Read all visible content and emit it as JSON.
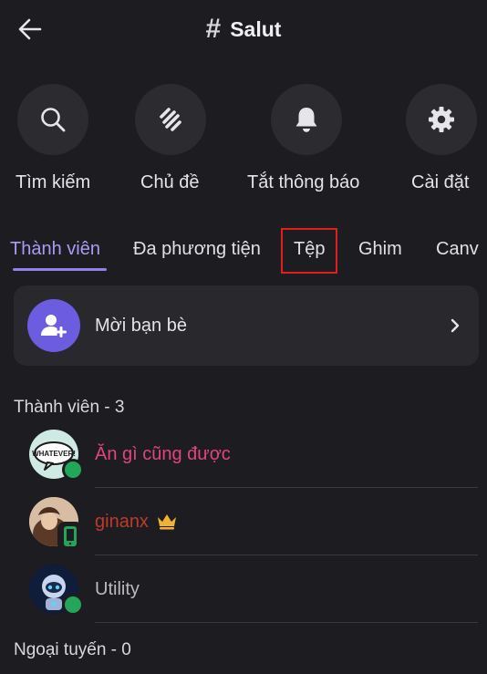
{
  "header": {
    "title": "Salut",
    "hash": "#"
  },
  "actions": [
    {
      "label": "Tìm kiếm",
      "icon": "search-icon"
    },
    {
      "label": "Chủ đề",
      "icon": "threads-icon"
    },
    {
      "label": "Tắt thông báo",
      "icon": "bell-icon"
    },
    {
      "label": "Cài đặt",
      "icon": "gear-icon"
    }
  ],
  "tabs": [
    {
      "label": "Thành viên",
      "active": true
    },
    {
      "label": "Đa phương tiện",
      "active": false
    },
    {
      "label": "Tệp",
      "active": false
    },
    {
      "label": "Ghim",
      "active": false
    },
    {
      "label": "Canv",
      "active": false
    }
  ],
  "invite": {
    "label": "Mời bạn bè"
  },
  "members_section": {
    "title": "Thành viên - 3"
  },
  "members": [
    {
      "name": "Ăn gì cũng được",
      "color": "#e0457b",
      "avatar_text": "WHATEVER!",
      "status": "online"
    },
    {
      "name": "ginanx",
      "color": "#c0392b",
      "status": "mobile",
      "badge": "crown-icon"
    },
    {
      "name": "Utility",
      "color": "#b9bbbe",
      "status": "online"
    }
  ],
  "offline_section": {
    "title": "Ngoại tuyến - 0"
  },
  "colors": {
    "accent": "#8f82ea",
    "online": "#23a55a",
    "highlight": "#e01e1e",
    "crown": "#f0b232"
  }
}
